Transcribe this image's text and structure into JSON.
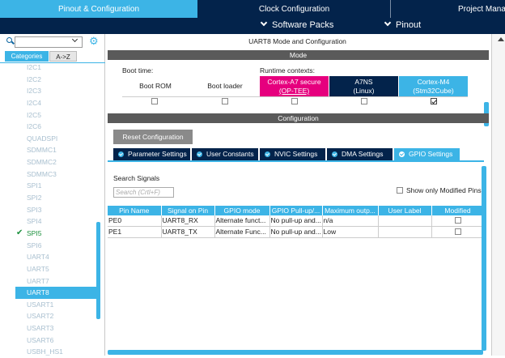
{
  "tabs": [
    "Pinout & Configuration",
    "Clock Configuration",
    "Project Manager"
  ],
  "subbar": {
    "software_packs": "Software Packs",
    "pinout": "Pinout"
  },
  "left": {
    "categories_tab": "Categories",
    "az_tab": "A->Z",
    "peripherals": [
      "I2C1",
      "I2C2",
      "I2C3",
      "I2C4",
      "I2C5",
      "I2C6",
      "QUADSPI",
      "SDMMC1",
      "SDMMC2",
      "SDMMC3",
      "SPI1",
      "SPI2",
      "SPI3",
      "SPI4",
      "SPI5",
      "SPI6",
      "UART4",
      "UART5",
      "UART7",
      "UART8",
      "USART1",
      "USART2",
      "USART3",
      "USART6",
      "USBH_HS1"
    ],
    "enabled": "SPI5",
    "selected": "UART8"
  },
  "right": {
    "title": "UART8 Mode and Configuration",
    "mode_bar": "Mode",
    "boot_time": "Boot time:",
    "runtime_contexts": "Runtime contexts:",
    "boot_rom": "Boot ROM",
    "boot_loader": "Boot loader",
    "ctx_a7_secure_1": "Cortex-A7 secure",
    "ctx_a7_secure_2": "(OP-TEE)",
    "ctx_a7ns_1": "A7NS",
    "ctx_a7ns_2": "(Linux)",
    "ctx_m4_1": "Cortex-M4",
    "ctx_m4_2": "(Stm32Cube)",
    "config_bar": "Configuration",
    "reset_button": "Reset Configuration",
    "param_tabs": [
      "Parameter Settings",
      "User Constants",
      "NVIC Settings",
      "DMA Settings",
      "GPIO Settings"
    ],
    "active_tab": "GPIO Settings",
    "search_signals": "Search Signals",
    "search_placeholder": "Search (Crtl+F)",
    "show_modified": "Show only Modified Pins",
    "table": {
      "headers": [
        "Pin Name",
        "Signal on Pin",
        "GPIO mode",
        "GPIO Pull-up/...",
        "Maximum outp...",
        "User Label",
        "Modified"
      ],
      "rows": [
        [
          "PE0",
          "UART8_RX",
          "Alternate funct...",
          "No pull-up and...",
          "n/a",
          "",
          ""
        ],
        [
          "PE1",
          "UART8_TX",
          "Alternate Func...",
          "No pull-up and...",
          "Low",
          "",
          ""
        ]
      ]
    }
  },
  "colors": {
    "accent": "#3cb4e6",
    "navy": "#03234b",
    "secure": "#e6007e",
    "enabled": "#1a8f3c"
  }
}
